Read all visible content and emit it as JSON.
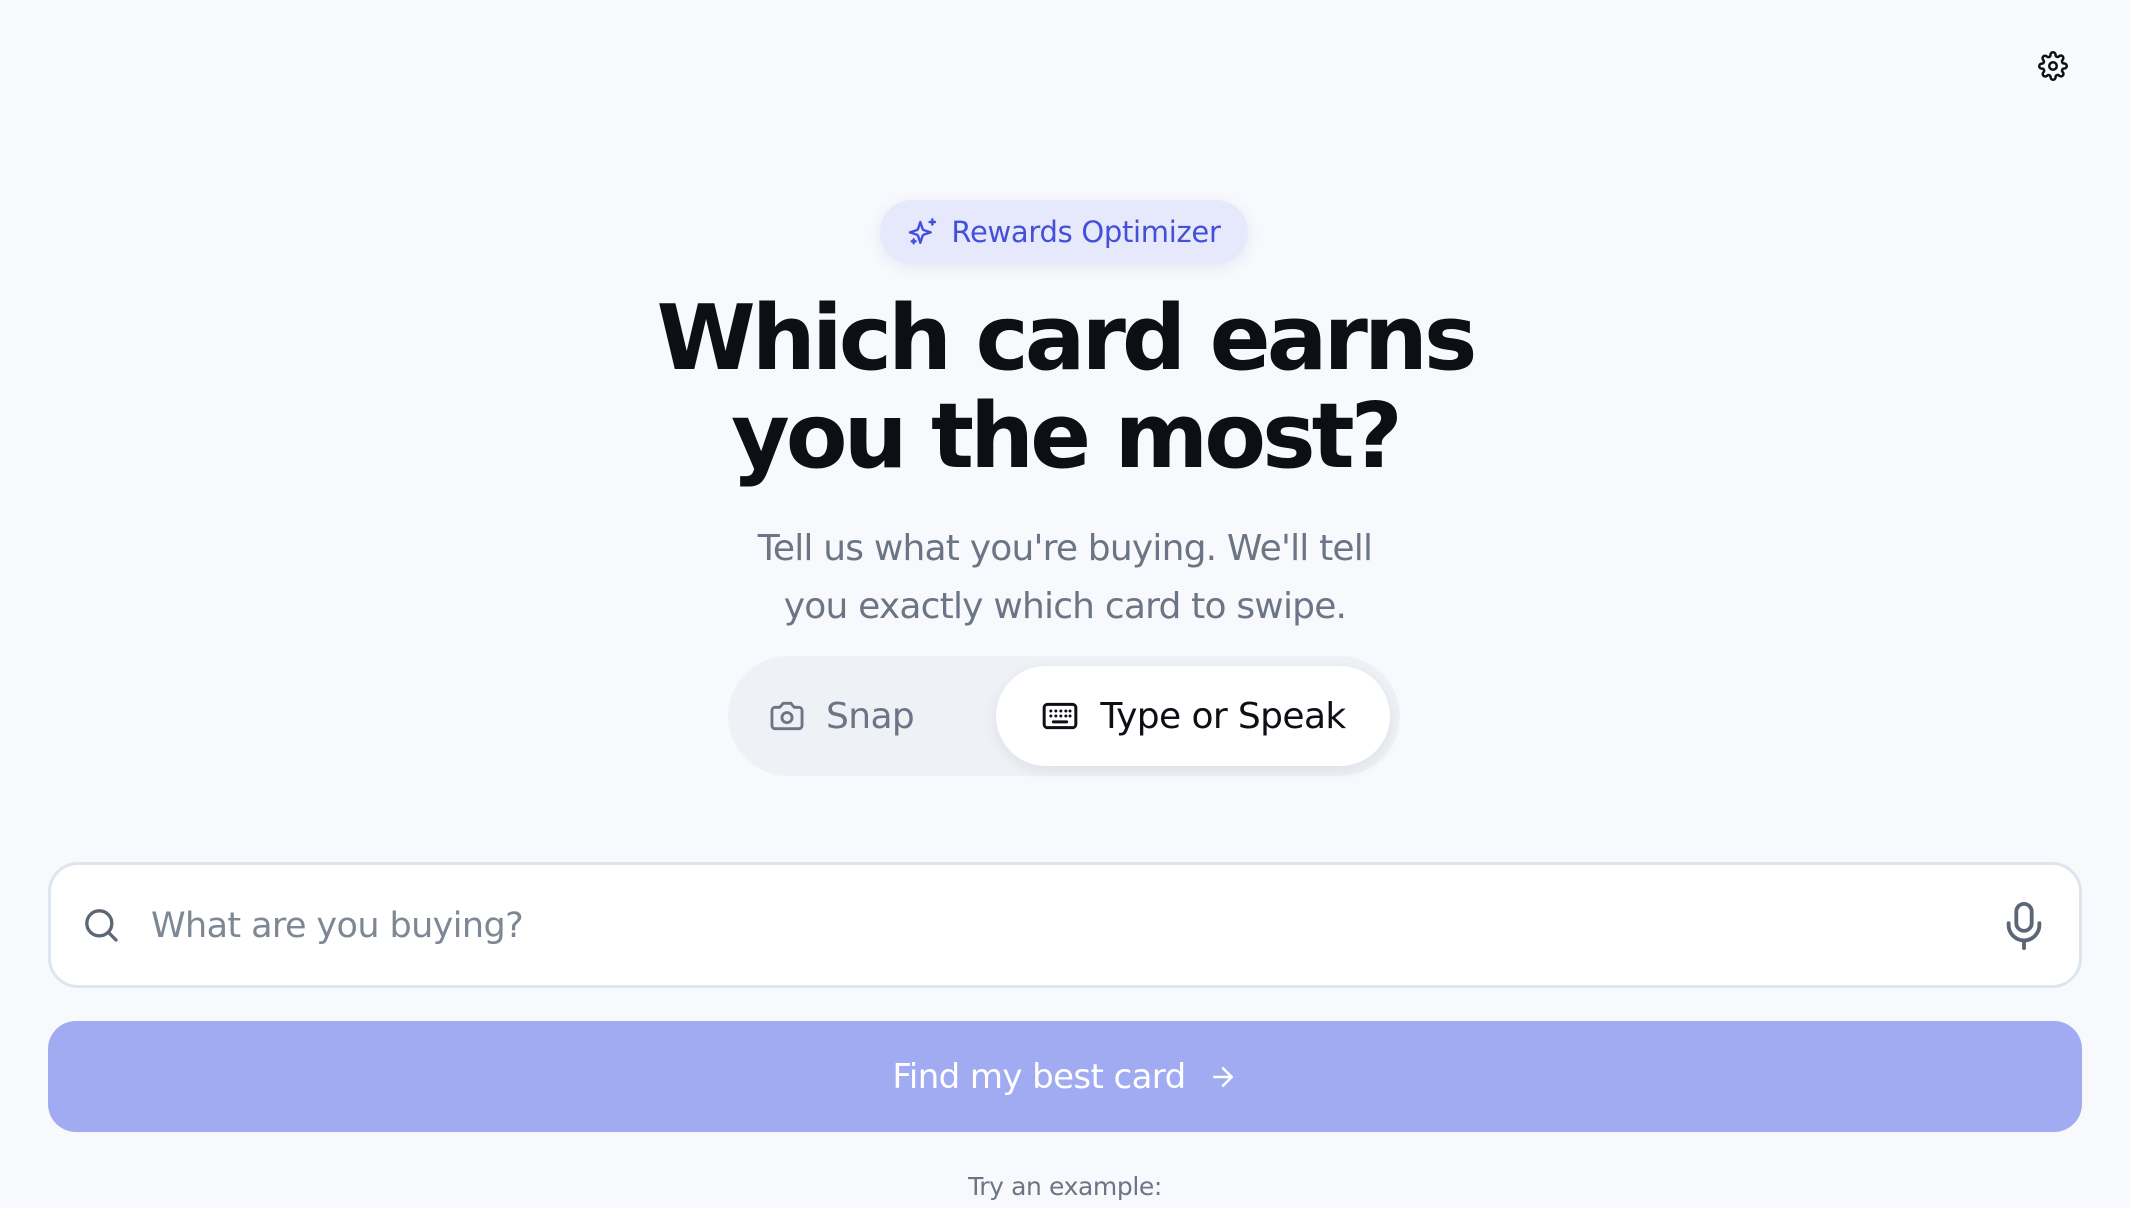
{
  "header": {
    "settings_icon": "gear-icon"
  },
  "hero": {
    "badge_icon": "sparkles-icon",
    "badge_label": "Rewards Optimizer",
    "headline_line1": "Which card earns",
    "headline_line2": "you the most?",
    "subtitle_line1": "Tell us what you're buying. We'll tell",
    "subtitle_line2": "you exactly which card to swipe."
  },
  "mode_toggle": {
    "options": [
      {
        "label": "Snap",
        "icon": "camera-icon",
        "selected": false
      },
      {
        "label": "Type or Speak",
        "icon": "keyboard-icon",
        "selected": true
      }
    ]
  },
  "search": {
    "placeholder": "What are you buying?",
    "value": "",
    "left_icon": "search-icon",
    "right_icon": "microphone-icon"
  },
  "cta": {
    "label": "Find my best card",
    "icon": "arrow-right-icon"
  },
  "examples": {
    "label": "Try an example:"
  },
  "colors": {
    "background": "#f8f9fc",
    "accent": "#4450d6",
    "badge_bg": "#e6e9fb",
    "cta_bg": "#a1abf1",
    "heading": "#0c0f14",
    "muted": "#6b7585"
  }
}
